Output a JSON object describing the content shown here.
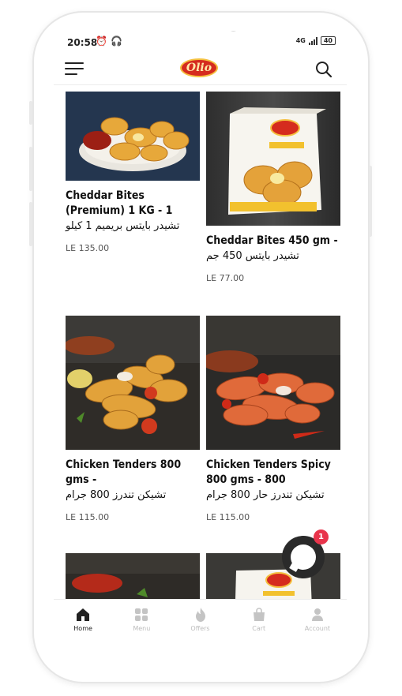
{
  "status_bar": {
    "time": "20:58",
    "network": "4G",
    "battery": "40"
  },
  "header": {
    "brand": "Olio"
  },
  "products": [
    {
      "title": "Cheddar Bites (Premium) 1 KG - 1",
      "subtitle": "تشيدر بايتس بريميم 1 كيلو",
      "price": "LE 135.00"
    },
    {
      "title": "Cheddar Bites 450 gm -",
      "subtitle": "تشيدر بايتس 450 جم",
      "price": "LE 77.00"
    },
    {
      "title": "Chicken Tenders 800 gms -",
      "subtitle": "تشيكن تندرز 800 جرام",
      "price": "LE 115.00"
    },
    {
      "title": "Chicken Tenders Spicy 800 gms - 800",
      "subtitle": "تشيكن تندرز حار 800 جرام",
      "price": "LE 115.00"
    }
  ],
  "chat": {
    "badge_count": "1"
  },
  "bottom_nav": [
    {
      "label": "Home",
      "icon": "home-icon",
      "active": true
    },
    {
      "label": "Menu",
      "icon": "grid-icon",
      "active": false
    },
    {
      "label": "Offers",
      "icon": "flame-icon",
      "active": false
    },
    {
      "label": "Cart",
      "icon": "bag-icon",
      "active": false
    },
    {
      "label": "Account",
      "icon": "user-icon",
      "active": false
    }
  ],
  "colors": {
    "brand_red": "#d52b1e",
    "brand_gold": "#f5c040",
    "badge": "#e8344b",
    "text": "#111111",
    "muted": "#bbbbbb"
  }
}
